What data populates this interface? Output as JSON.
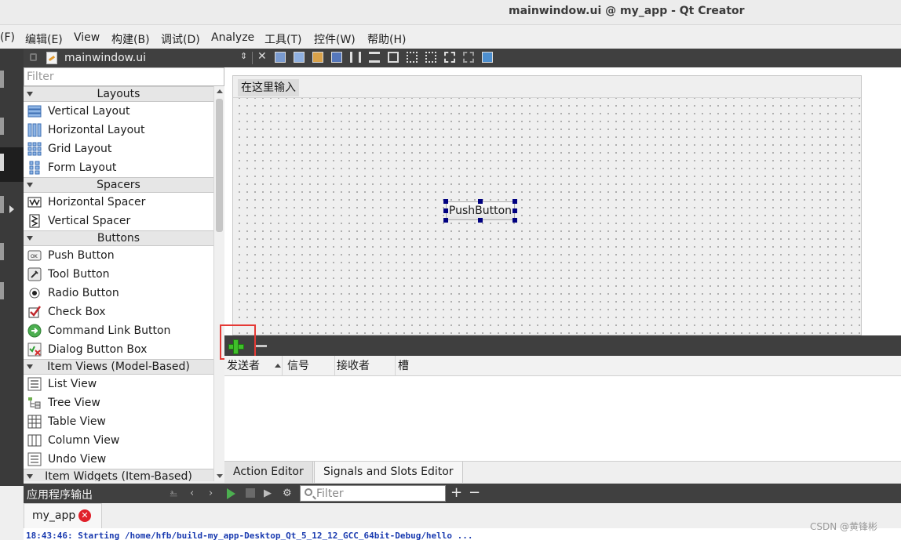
{
  "window": {
    "title": "mainwindow.ui @ my_app - Qt Creator"
  },
  "menubar": {
    "items": [
      "(F)",
      "编辑(E)",
      "View",
      "构建(B)",
      "调试(D)",
      "Analyze",
      "工具(T)",
      "控件(W)",
      "帮助(H)"
    ]
  },
  "document": {
    "file_name": "mainwindow.ui"
  },
  "widget_box": {
    "filter_placeholder": "Filter",
    "categories": [
      {
        "title": "Layouts",
        "items": [
          {
            "label": "Vertical Layout",
            "icon": "vertical-layout-icon"
          },
          {
            "label": "Horizontal Layout",
            "icon": "horizontal-layout-icon"
          },
          {
            "label": "Grid Layout",
            "icon": "grid-layout-icon"
          },
          {
            "label": "Form Layout",
            "icon": "form-layout-icon"
          }
        ]
      },
      {
        "title": "Spacers",
        "items": [
          {
            "label": "Horizontal Spacer",
            "icon": "horizontal-spacer-icon"
          },
          {
            "label": "Vertical Spacer",
            "icon": "vertical-spacer-icon"
          }
        ]
      },
      {
        "title": "Buttons",
        "items": [
          {
            "label": "Push Button",
            "icon": "push-button-icon"
          },
          {
            "label": "Tool Button",
            "icon": "tool-button-icon"
          },
          {
            "label": "Radio Button",
            "icon": "radio-button-icon"
          },
          {
            "label": "Check Box",
            "icon": "check-box-icon"
          },
          {
            "label": "Command Link Button",
            "icon": "command-link-icon"
          },
          {
            "label": "Dialog Button Box",
            "icon": "dialog-button-box-icon"
          }
        ]
      },
      {
        "title": "Item Views (Model-Based)",
        "items": [
          {
            "label": "List View",
            "icon": "list-view-icon"
          },
          {
            "label": "Tree View",
            "icon": "tree-view-icon"
          },
          {
            "label": "Table View",
            "icon": "table-view-icon"
          },
          {
            "label": "Column View",
            "icon": "column-view-icon"
          },
          {
            "label": "Undo View",
            "icon": "undo-view-icon"
          }
        ]
      },
      {
        "title": "Item Widgets (Item-Based)",
        "items": []
      }
    ]
  },
  "form": {
    "menu_placeholder": "在这里输入",
    "push_button_label": "PushButton"
  },
  "signals_slots": {
    "columns": [
      "发送者",
      "信号",
      "接收者",
      "槽"
    ]
  },
  "editor_tabs": [
    "Action Editor",
    "Signals and Slots Editor"
  ],
  "output": {
    "title": "应用程序输出",
    "filter_placeholder": "Filter",
    "tab_label": "my_app",
    "log_line": "18:43:46: Starting /home/hfb/build-my_app-Desktop_Qt_5_12_12_GCC_64bit-Debug/hello ..."
  },
  "watermark": "CSDN @黄锋彬",
  "colors": {
    "accent_green": "#3fbf2a",
    "highlight_red": "#e53935",
    "selection_handle": "#000080",
    "log_blue": "#1a3bb0"
  }
}
